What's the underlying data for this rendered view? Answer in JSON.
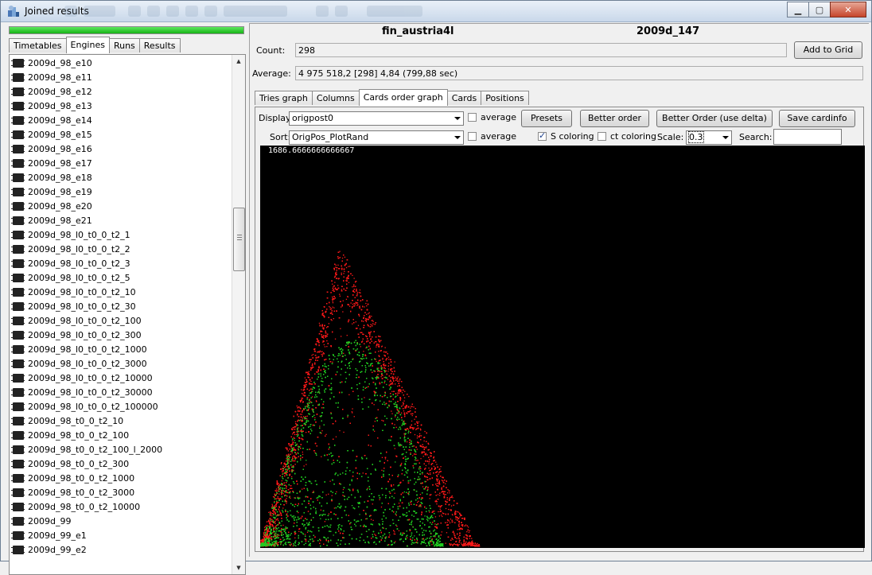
{
  "window": {
    "title": "Joined results"
  },
  "left": {
    "progress": 1.0,
    "tabs": [
      {
        "label": "Timetables",
        "active": false
      },
      {
        "label": "Engines",
        "active": true
      },
      {
        "label": "Runs",
        "active": false
      },
      {
        "label": "Results",
        "active": false
      }
    ],
    "items": [
      "2009d_98_e10",
      "2009d_98_e11",
      "2009d_98_e12",
      "2009d_98_e13",
      "2009d_98_e14",
      "2009d_98_e15",
      "2009d_98_e16",
      "2009d_98_e17",
      "2009d_98_e18",
      "2009d_98_e19",
      "2009d_98_e20",
      "2009d_98_e21",
      "2009d_98_l0_t0_0_t2_1",
      "2009d_98_l0_t0_0_t2_2",
      "2009d_98_l0_t0_0_t2_3",
      "2009d_98_l0_t0_0_t2_5",
      "2009d_98_l0_t0_0_t2_10",
      "2009d_98_l0_t0_0_t2_30",
      "2009d_98_l0_t0_0_t2_100",
      "2009d_98_l0_t0_0_t2_300",
      "2009d_98_l0_t0_0_t2_1000",
      "2009d_98_l0_t0_0_t2_3000",
      "2009d_98_l0_t0_0_t2_10000",
      "2009d_98_l0_t0_0_t2_30000",
      "2009d_98_l0_t0_0_t2_100000",
      "2009d_98_t0_0_t2_10",
      "2009d_98_t0_0_t2_100",
      "2009d_98_t0_0_t2_100_l_2000",
      "2009d_98_t0_0_t2_300",
      "2009d_98_t0_0_t2_1000",
      "2009d_98_t0_0_t2_3000",
      "2009d_98_t0_0_t2_10000",
      "2009d_99",
      "2009d_99_e1",
      "2009d_99_e2"
    ]
  },
  "right": {
    "header_left": "fin_austria4l",
    "header_right": "2009d_147",
    "count_label": "Count:",
    "count_value": "298",
    "add_to_grid": "Add to Grid",
    "average_label": "Average:",
    "average_value": "4 975 518,2 [298] 4,84     (799,88 sec)",
    "tabs": [
      {
        "label": "Tries graph",
        "active": false
      },
      {
        "label": "Columns",
        "active": false
      },
      {
        "label": "Cards order graph",
        "active": true
      },
      {
        "label": "Cards",
        "active": false
      },
      {
        "label": "Positions",
        "active": false
      }
    ],
    "display_label": "Display:",
    "display_value": "origpost0",
    "average_check_1": "average",
    "presets": "Presets",
    "better_order": "Better order",
    "better_order_delta": "Better Order (use delta)",
    "save_cardinfo": "Save cardinfo",
    "sort_label": "Sort:",
    "sort_value": "OrigPos_PlotRand",
    "average_check_2": "average",
    "s_coloring": "S coloring",
    "s_coloring_checked": true,
    "ct_coloring": "ct coloring",
    "ct_coloring_checked": false,
    "scale_label": "Scale:",
    "scale_value": "0.3",
    "search_label": "Search:",
    "search_value": "",
    "plot_max": "1686.6666666666667",
    "colors": {
      "red_series": "#ff1a1a",
      "green_series": "#22cc22",
      "plot_bg": "#000000"
    }
  }
}
